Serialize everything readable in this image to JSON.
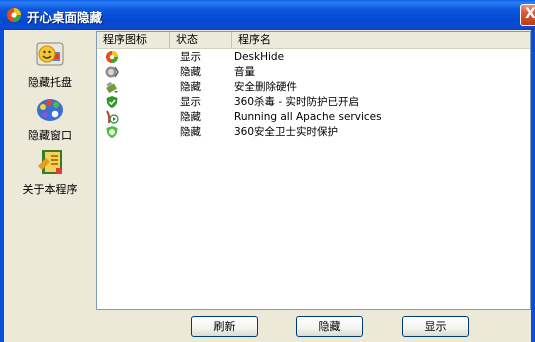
{
  "window": {
    "title": "开心桌面隐藏",
    "close_label": "X"
  },
  "sidebar": {
    "items": [
      {
        "label": "隐藏托盘",
        "icon": "tray-smiley-icon"
      },
      {
        "label": "隐藏窗口",
        "icon": "palette-window-icon"
      },
      {
        "label": "关于本程序",
        "icon": "about-icon"
      }
    ]
  },
  "list": {
    "columns": [
      "程序图标",
      "状态",
      "程序名"
    ],
    "rows": [
      {
        "icon": "deskhide-icon",
        "status": "显示",
        "name": "DeskHide"
      },
      {
        "icon": "volume-icon",
        "status": "隐藏",
        "name": "音量"
      },
      {
        "icon": "safe-remove-hardware-icon",
        "status": "隐藏",
        "name": "安全删除硬件"
      },
      {
        "icon": "360-antivirus-icon",
        "status": "显示",
        "name": "360杀毒 - 实时防护已开启"
      },
      {
        "icon": "apache-icon",
        "status": "隐藏",
        "name": "Running all Apache services"
      },
      {
        "icon": "360-safeguard-icon",
        "status": "隐藏",
        "name": "360安全卫士实时保护"
      }
    ]
  },
  "buttons": {
    "refresh": "刷新",
    "hide": "隐藏",
    "show": "显示"
  }
}
